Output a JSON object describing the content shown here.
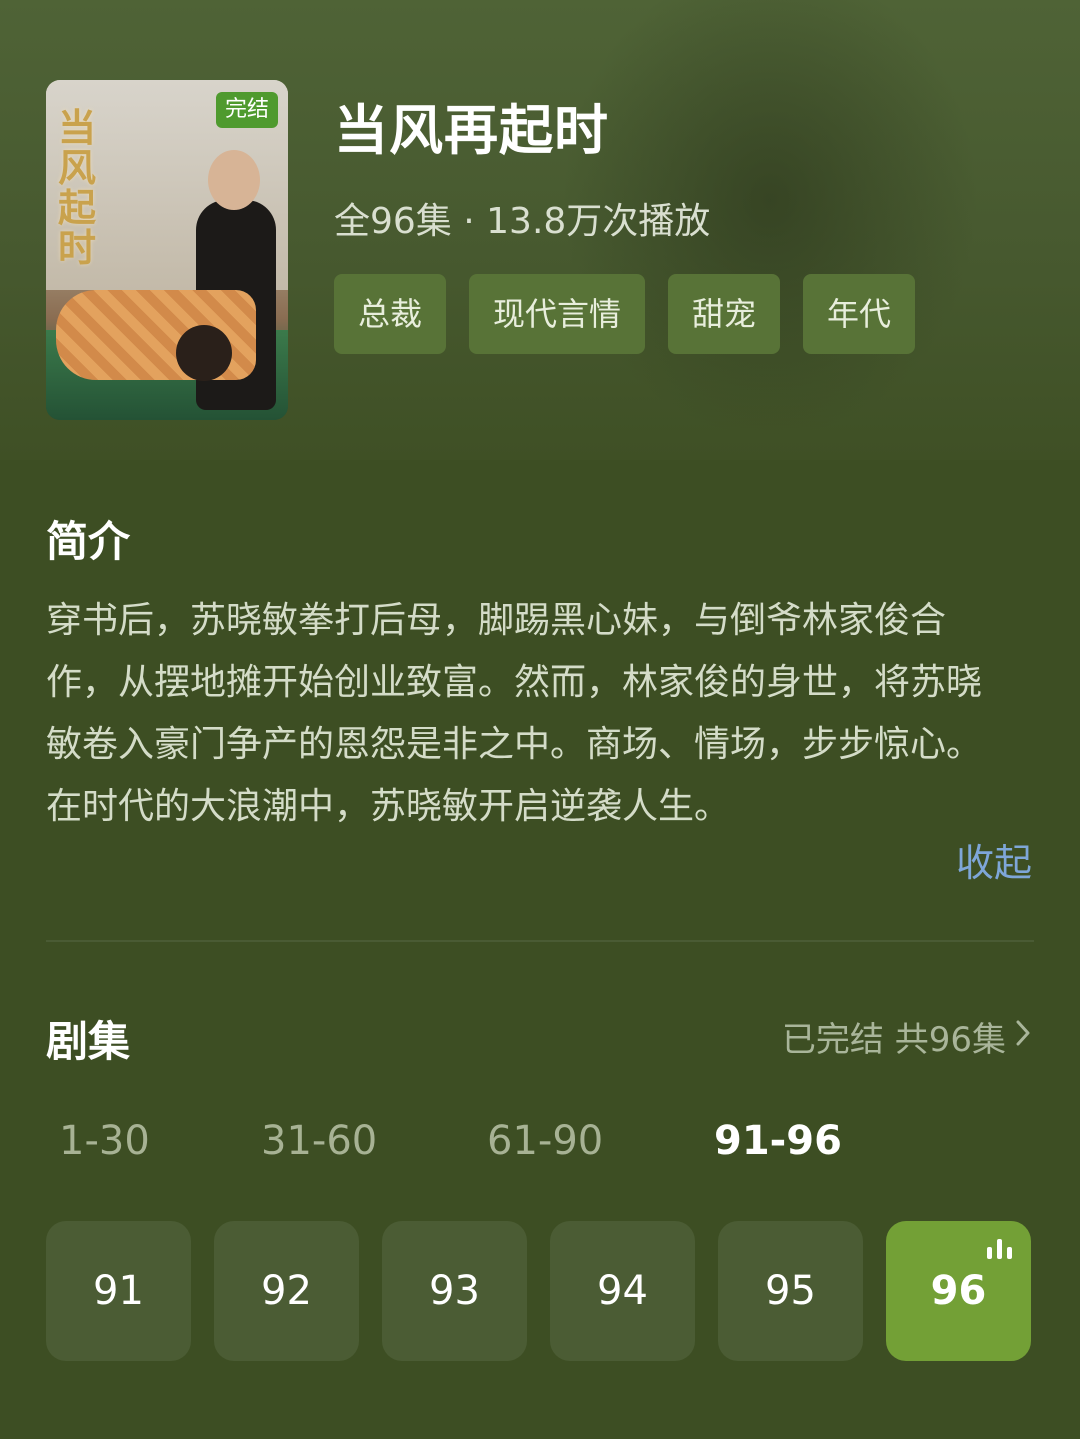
{
  "drama": {
    "title": "当风再起时",
    "badge": "完结",
    "meta": "全96集 · 13.8万次播放",
    "tags": [
      "总裁",
      "现代言情",
      "甜宠",
      "年代"
    ]
  },
  "intro": {
    "heading": "简介",
    "text": "穿书后，苏晓敏拳打后母，脚踢黑心妹，与倒爷林家俊合作，从摆地摊开始创业致富。然而，林家俊的身世，将苏晓敏卷入豪门争产的恩怨是非之中。商场、情场，步步惊心。在时代的大浪潮中，苏晓敏开启逆袭人生。",
    "collapse_label": "收起"
  },
  "episodes": {
    "heading": "剧集",
    "status": "已完结 共96集",
    "ranges": [
      "1-30",
      "31-60",
      "61-90",
      "91-96"
    ],
    "selected_range": "91-96",
    "items": [
      "91",
      "92",
      "93",
      "94",
      "95",
      "96"
    ],
    "current": "96"
  },
  "icons": {
    "status_chevron": "chevron-right-icon",
    "playing": "playing-bars-icon"
  },
  "colors": {
    "background": "#3d4e23",
    "tag_bg": "#587337",
    "episode_bg": "#4b5c34",
    "active_episode_bg": "#73a036",
    "badge_bg": "#4f9a2e",
    "link": "#7ea6d8"
  }
}
